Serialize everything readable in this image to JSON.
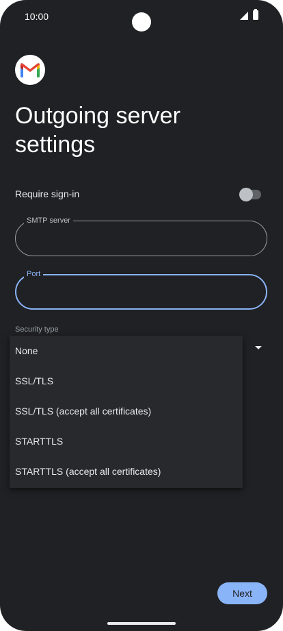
{
  "status_bar": {
    "time": "10:00"
  },
  "page": {
    "title": "Outgoing server settings"
  },
  "require_signin": {
    "label": "Require sign-in",
    "enabled": false
  },
  "smtp_server": {
    "label": "SMTP server",
    "value": ""
  },
  "port": {
    "label": "Port",
    "value": ""
  },
  "security_type": {
    "label": "Security type",
    "options": [
      "None",
      "SSL/TLS",
      "SSL/TLS (accept all certificates)",
      "STARTTLS",
      "STARTTLS (accept all certificates)"
    ]
  },
  "next_button": {
    "label": "Next"
  },
  "colors": {
    "background": "#202124",
    "accent": "#8ab4f8",
    "menu": "#28292c",
    "text": "#e8eaed"
  },
  "icons": {
    "logo": "gmail-icon",
    "signal": "signal-icon",
    "battery": "battery-icon",
    "dropdown": "dropdown-arrow-icon"
  }
}
